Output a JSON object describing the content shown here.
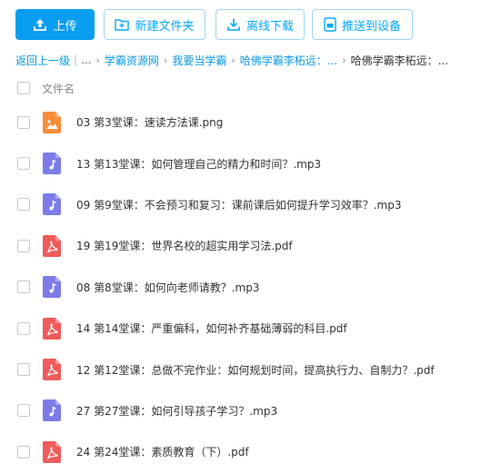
{
  "toolbar": {
    "upload": "上传",
    "new_folder": "新建文件夹",
    "offline_download": "离线下载",
    "push_device": "推送到设备"
  },
  "breadcrumb": {
    "back": "返回上一级",
    "separator": "›",
    "ellipsis": "...",
    "items": [
      "学霸资源网",
      "我要当学霸",
      "哈佛学霸李柘远：..."
    ],
    "current": "哈佛学霸李柘远：..."
  },
  "list_header": {
    "column_filename": "文件名"
  },
  "files": [
    {
      "name": "03 第3堂课：速读方法课.png",
      "type": "image"
    },
    {
      "name": "13 第13堂课：如何管理自己的精力和时间？.mp3",
      "type": "audio"
    },
    {
      "name": "09 第9堂课：不会预习和复习：课前课后如何提升学习效率？.mp3",
      "type": "audio"
    },
    {
      "name": "19 第19堂课：世界名校的超实用学习法.pdf",
      "type": "pdf"
    },
    {
      "name": "08 第8堂课：如何向老师请教？.mp3",
      "type": "audio"
    },
    {
      "name": "14 第14堂课：严重偏科，如何补齐基础薄弱的科目.pdf",
      "type": "pdf"
    },
    {
      "name": "12 第12堂课：总做不完作业：如何规划时间，提高执行力、自制力？.pdf",
      "type": "pdf"
    },
    {
      "name": "27 第27堂课：如何引导孩子学习？.mp3",
      "type": "audio"
    },
    {
      "name": "24 第24堂课：素质教育（下）.pdf",
      "type": "pdf"
    }
  ],
  "icon_colors": {
    "image": "#f58c3a",
    "audio": "#7c7ce8",
    "pdf": "#ef5b5b"
  },
  "accent": "#06a7ff"
}
